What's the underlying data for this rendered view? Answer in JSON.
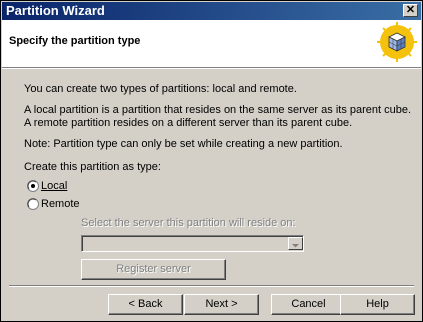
{
  "window": {
    "title": "Partition Wizard",
    "close_glyph": "✕"
  },
  "header": {
    "title": "Specify the partition type",
    "icon": "cube-wizard-icon"
  },
  "body": {
    "intro": "You can create two types of partitions: local and remote.",
    "description": "A local partition is a partition that resides on the same server as its parent cube. A remote partition resides on a different server than its parent cube.",
    "note": "Note: Partition type can only be set while creating a new partition.",
    "create_label": "Create this partition as type:",
    "options": [
      {
        "label": "Local",
        "selected": true
      },
      {
        "label": "Remote",
        "selected": false
      }
    ],
    "server_label": "Select the server this partition will reside on:",
    "server_value": "",
    "register_button": "Register server"
  },
  "buttons": {
    "back": "< Back",
    "next": "Next >",
    "cancel": "Cancel",
    "help": "Help"
  },
  "colors": {
    "title_start": "#0a246a",
    "title_end": "#3a6ea5",
    "face": "#d4d0c8",
    "icon_yellow": "#f4c20d"
  }
}
